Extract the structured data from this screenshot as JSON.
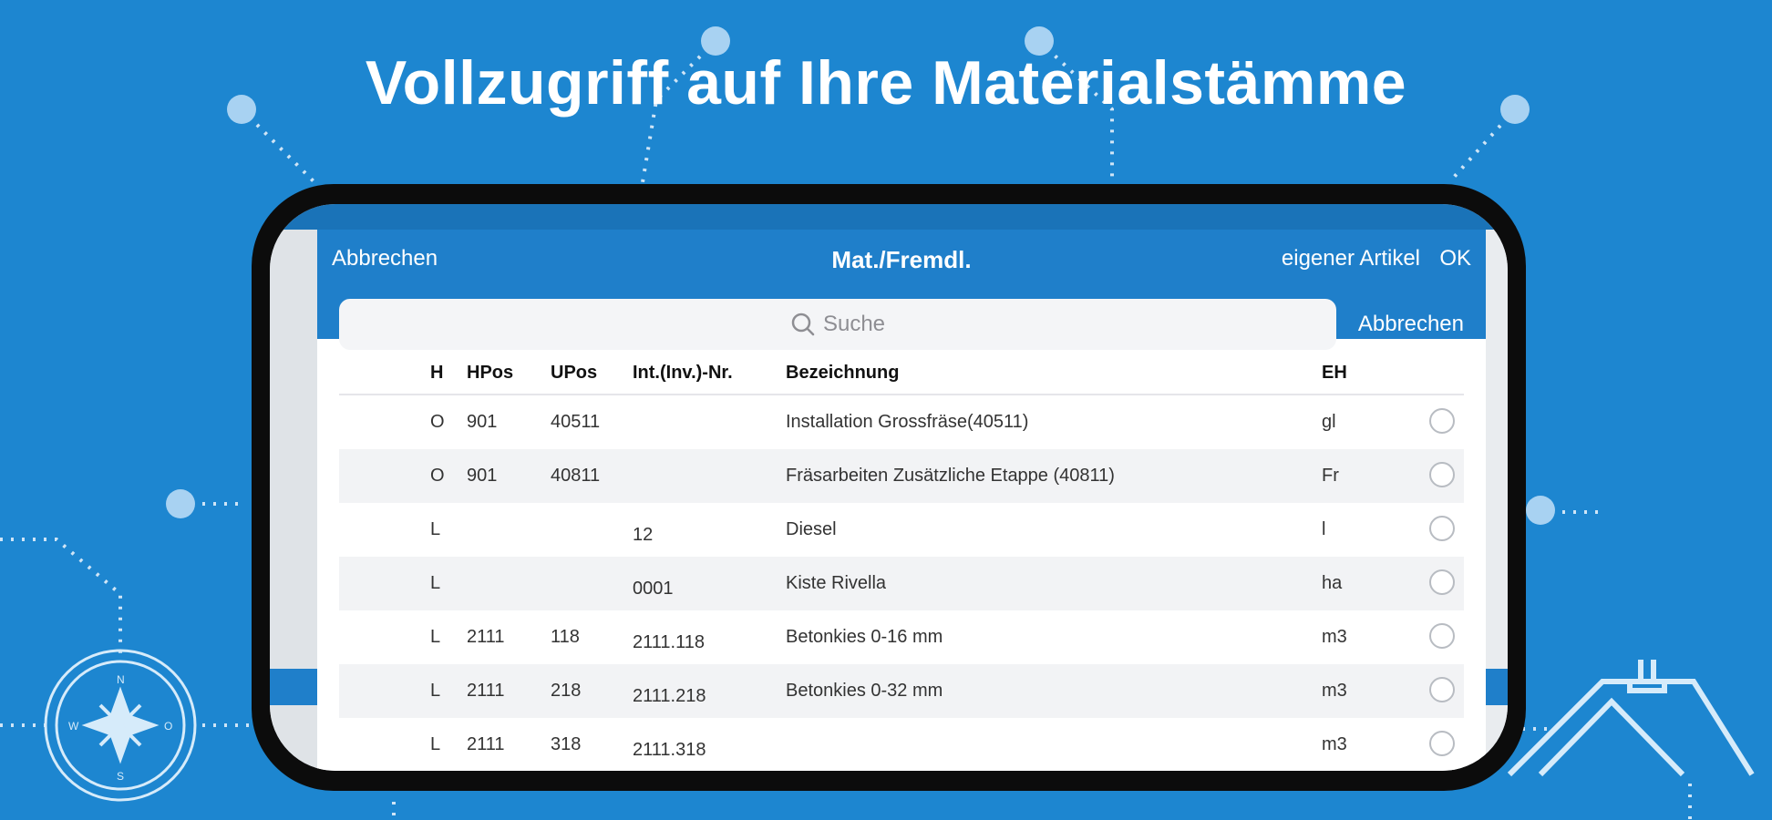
{
  "headline": "Vollzugriff auf Ihre Materialstämme",
  "decorations": {
    "compass_icon": "compass-icon",
    "compass_letters": [
      "N",
      "O",
      "S",
      "W"
    ],
    "house_icon": "house-outline-icon"
  },
  "dialog": {
    "cancel_label": "Abbrechen",
    "title": "Mat./Fremdl.",
    "own_article_label": "eigener Artikel",
    "ok_label": "OK",
    "search": {
      "placeholder": "Suche",
      "cancel_label": "Abbrechen"
    },
    "table": {
      "headers": {
        "h": "H",
        "hpos": "HPos",
        "upos": "UPos",
        "int_nr": "Int.(Inv.)-Nr.",
        "bezeichnung": "Bezeichnung",
        "eh": "EH"
      },
      "rows": [
        {
          "h": "O",
          "hpos": "901",
          "upos": "40511",
          "int_nr": "",
          "bezeichnung": "Installation Grossfräse(40511)",
          "eh": "gl"
        },
        {
          "h": "O",
          "hpos": "901",
          "upos": "40811",
          "int_nr": "",
          "bezeichnung": "Fräsarbeiten Zusätzliche Etappe (40811)",
          "eh": "Fr"
        },
        {
          "h": "L",
          "hpos": "",
          "upos": "",
          "int_nr": "12",
          "bezeichnung": "Diesel",
          "eh": "l"
        },
        {
          "h": "L",
          "hpos": "",
          "upos": "",
          "int_nr": "0001",
          "bezeichnung": "Kiste Rivella",
          "eh": "ha"
        },
        {
          "h": "L",
          "hpos": "2111",
          "upos": "118",
          "int_nr": "2111.118",
          "bezeichnung": "Betonkies 0-16 mm",
          "eh": "m3"
        },
        {
          "h": "L",
          "hpos": "2111",
          "upos": "218",
          "int_nr": "2111.218",
          "bezeichnung": "Betonkies 0-32 mm",
          "eh": "m3"
        },
        {
          "h": "L",
          "hpos": "2111",
          "upos": "318",
          "int_nr": "2111.318",
          "bezeichnung": "",
          "eh": "m3"
        }
      ]
    }
  },
  "colors": {
    "background": "#1d86d0",
    "navbar": "#1f7fca",
    "phone_frame": "#0c0c0c",
    "row_alt": "#f2f3f5"
  }
}
